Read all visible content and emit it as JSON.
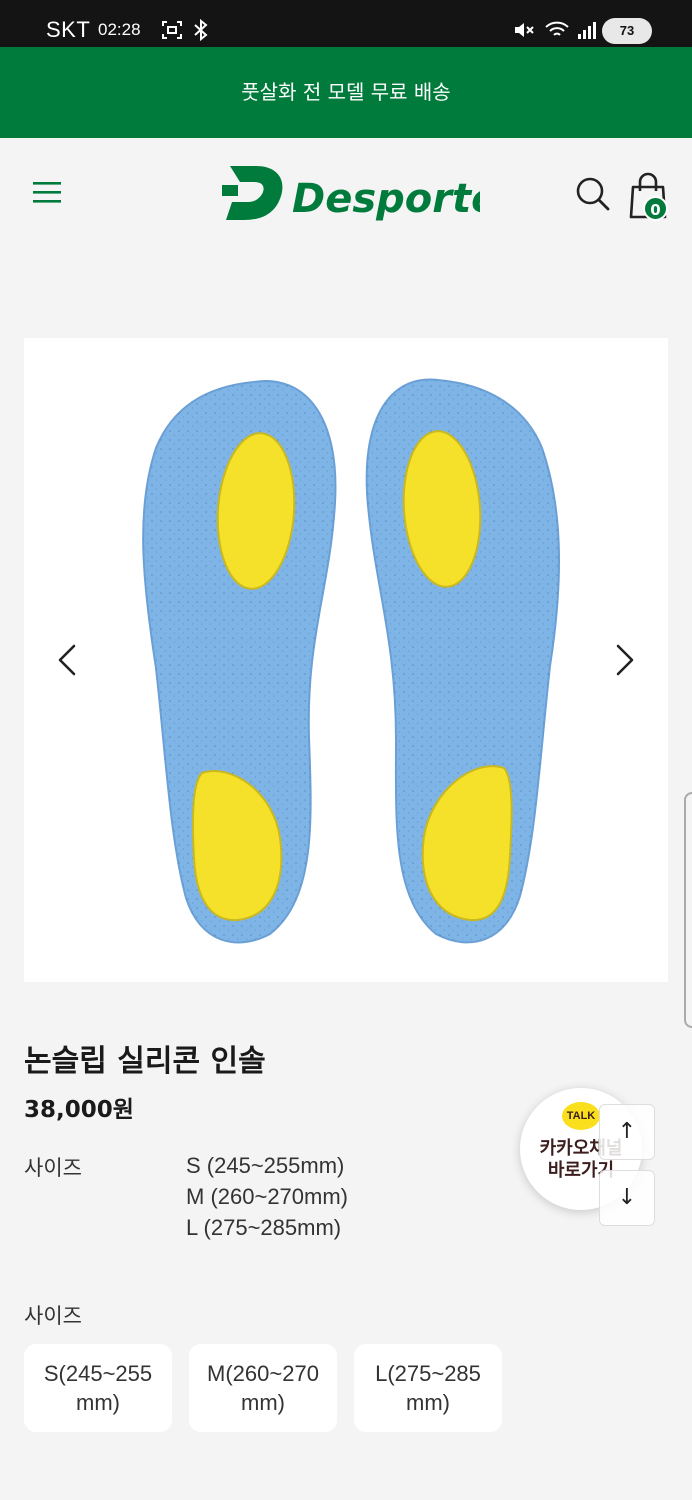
{
  "status_bar": {
    "carrier": "SKT",
    "time": "02:28",
    "battery": "73"
  },
  "promo_banner": {
    "text": "풋살화 전 모델 무료 배송"
  },
  "header": {
    "brand": "Desporte",
    "cart_count": "0"
  },
  "colors": {
    "brand_green": "#007b3c",
    "insole_blue": "#7fb4e6",
    "insole_yellow": "#f5e12a",
    "kakao_yellow": "#f9df1c"
  },
  "product": {
    "title": "논슬립 실리콘 인솔",
    "price": "38,000원",
    "spec_label": "사이즈",
    "spec_values": [
      "S (245~255mm)",
      "M (260~270mm)",
      "L (275~285mm)"
    ]
  },
  "options": {
    "label": "사이즈",
    "items": [
      {
        "line1": "S(245~255",
        "line2": "mm)"
      },
      {
        "line1": "M(260~270",
        "line2": "mm)"
      },
      {
        "line1": "L(275~285",
        "line2": "mm)"
      }
    ]
  },
  "kakao": {
    "badge": "TALK",
    "line1": "카카오채널",
    "line2": "바로가기"
  },
  "scroll_buttons": {
    "up": "↑",
    "down": "↓"
  }
}
